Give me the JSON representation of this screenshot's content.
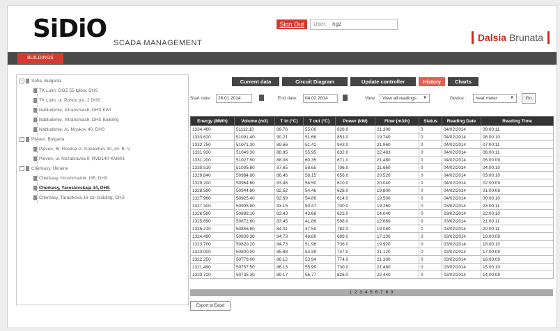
{
  "header": {
    "logo": "SiDiO",
    "subtitle": "SCADA MANAGEMENT",
    "sign_out": "Sign Out",
    "user_label": "User:",
    "user_value": "ngz",
    "brand_red": "Dalsia",
    "brand_gray": "Brunata"
  },
  "nav": {
    "buildings": "BUILDINGS"
  },
  "tree": {
    "items": [
      {
        "label": "Sofia, Bulgaria"
      },
      {
        "label": "TK Lulin, OOZ 55 Iglika, DHS"
      },
      {
        "label": "TK Lulin, ul. Portov pst, 2 DHS"
      },
      {
        "label": "Nabludenie, Intransmash, DHS KIVI"
      },
      {
        "label": "Nabludenie, Intransmash, DHS Building"
      },
      {
        "label": "Nabludenie, Al. Moskov 40, DHS"
      },
      {
        "label": "Pleven, Bulgaria"
      },
      {
        "label": "Pleven, Bl. Rositsa G. Kovatchev 30, vh. B, V"
      },
      {
        "label": "Pleven, ul. Nezabravka 9, RVD140-KM601"
      },
      {
        "label": "Cherkasy, Ukraine"
      },
      {
        "label": "Cherkasy, Hroshchatnik 185, DHS"
      },
      {
        "label": "Cherkasy, Yaroslavskaja 34, DHS"
      },
      {
        "label": "Cherkasy, Tarasikova 16 Ion building, DHS"
      }
    ]
  },
  "tabs": [
    "Current data",
    "Circuit Diagram",
    "Update controller",
    "History",
    "Charts"
  ],
  "active_tab": "History",
  "filters": {
    "start_label": "Start date:",
    "start_value": "28.01.2014",
    "end_label": "End date:",
    "end_value": "04.02.2014",
    "view_label": "View:",
    "view_value": "View all readings",
    "device_label": "Device :",
    "device_value": "heat meter",
    "go": "Go"
  },
  "table": {
    "headers": [
      "Energy (MWh)",
      "Volume (m3)",
      "T in (°C)",
      "T out (°C)",
      "Power (kW)",
      "Flow (m3/h)",
      "Status",
      "Reading Date",
      "Reading Time"
    ],
    "rows": [
      [
        "1334.460",
        "51112.10",
        "89.76",
        "55.06",
        "828.0",
        "21.300",
        "0",
        "04/02/2014",
        "09:00:11"
      ],
      [
        "1333.620",
        "51091.40",
        "90.21",
        "51.66",
        "853.0",
        "19.740",
        "0",
        "04/02/2014",
        "08:00:10"
      ],
      [
        "1332.750",
        "51071.30",
        "89.66",
        "51.42",
        "943.0",
        "21.960",
        "0",
        "04/02/2014",
        "07:00:11"
      ],
      [
        "1331.920",
        "51049.30",
        "88.85",
        "55.95",
        "832.0",
        "22.483",
        "0",
        "04/02/2014",
        "06:00:11"
      ],
      [
        "1331.200",
        "51027.50",
        "88.08",
        "60.35",
        "671.0",
        "21.480",
        "0",
        "04/02/2014",
        "05:00:09"
      ],
      [
        "1330.510",
        "51005.80",
        "87.65",
        "58.65",
        "706.0",
        "21.660",
        "0",
        "04/02/2014",
        "04:00:10"
      ],
      [
        "1329.840",
        "50984.80",
        "86.46",
        "58.15",
        "656.0",
        "20.520",
        "0",
        "04/02/2014",
        "03:00:10"
      ],
      [
        "1329.200",
        "50964.60",
        "83.46",
        "56.50",
        "610.0",
        "20.040",
        "0",
        "04/02/2014",
        "02:00:09"
      ],
      [
        "1328.590",
        "50944.80",
        "82.52",
        "54.46",
        "628.0",
        "19.800",
        "0",
        "04/02/2014",
        "01:00:08"
      ],
      [
        "1327.960",
        "50925.40",
        "82.69",
        "54.86",
        "614.0",
        "19.500",
        "0",
        "04/02/2014",
        "00:00:10"
      ],
      [
        "1327.300",
        "50905.90",
        "83.15",
        "50.47",
        "700.0",
        "19.260",
        "0",
        "03/02/2014",
        "23:00:11"
      ],
      [
        "1326.590",
        "50888.10",
        "83.43",
        "43.66",
        "623.0",
        "14.040",
        "0",
        "03/02/2014",
        "22:00:10"
      ],
      [
        "1325.890",
        "50872.60",
        "83.45",
        "41.86",
        "598.0",
        "12.660",
        "0",
        "03/02/2014",
        "21:00:11"
      ],
      [
        "1325.210",
        "50856.90",
        "84.01",
        "47.59",
        "782.0",
        "19.080",
        "0",
        "03/02/2014",
        "20:00:11"
      ],
      [
        "1324.490",
        "50839.30",
        "84.73",
        "48.89",
        "689.0",
        "17.100",
        "0",
        "03/02/2014",
        "19:00:09"
      ],
      [
        "1323.700",
        "50820.20",
        "84.73",
        "51.96",
        "736.0",
        "19.920",
        "0",
        "03/02/2014",
        "18:00:10"
      ],
      [
        "1323.000",
        "50800.00",
        "85.88",
        "54.39",
        "747.0",
        "21.120",
        "0",
        "03/02/2014",
        "17:00:09"
      ],
      [
        "1322.250",
        "50779.00",
        "86.12",
        "53.94",
        "774.0",
        "21.300",
        "0",
        "03/02/2014",
        "16:00:09"
      ],
      [
        "1321.490",
        "50757.50",
        "86.13",
        "55.99",
        "730.0",
        "21.480",
        "0",
        "03/02/2014",
        "15:00:10"
      ],
      [
        "1320.720",
        "50735.30",
        "89.17",
        "56.77",
        "826.0",
        "22.440",
        "0",
        "03/02/2014",
        "14:00:09"
      ]
    ]
  },
  "pager": "1 2 3 4 5 6 7 8 9",
  "export": "Export to Excel"
}
